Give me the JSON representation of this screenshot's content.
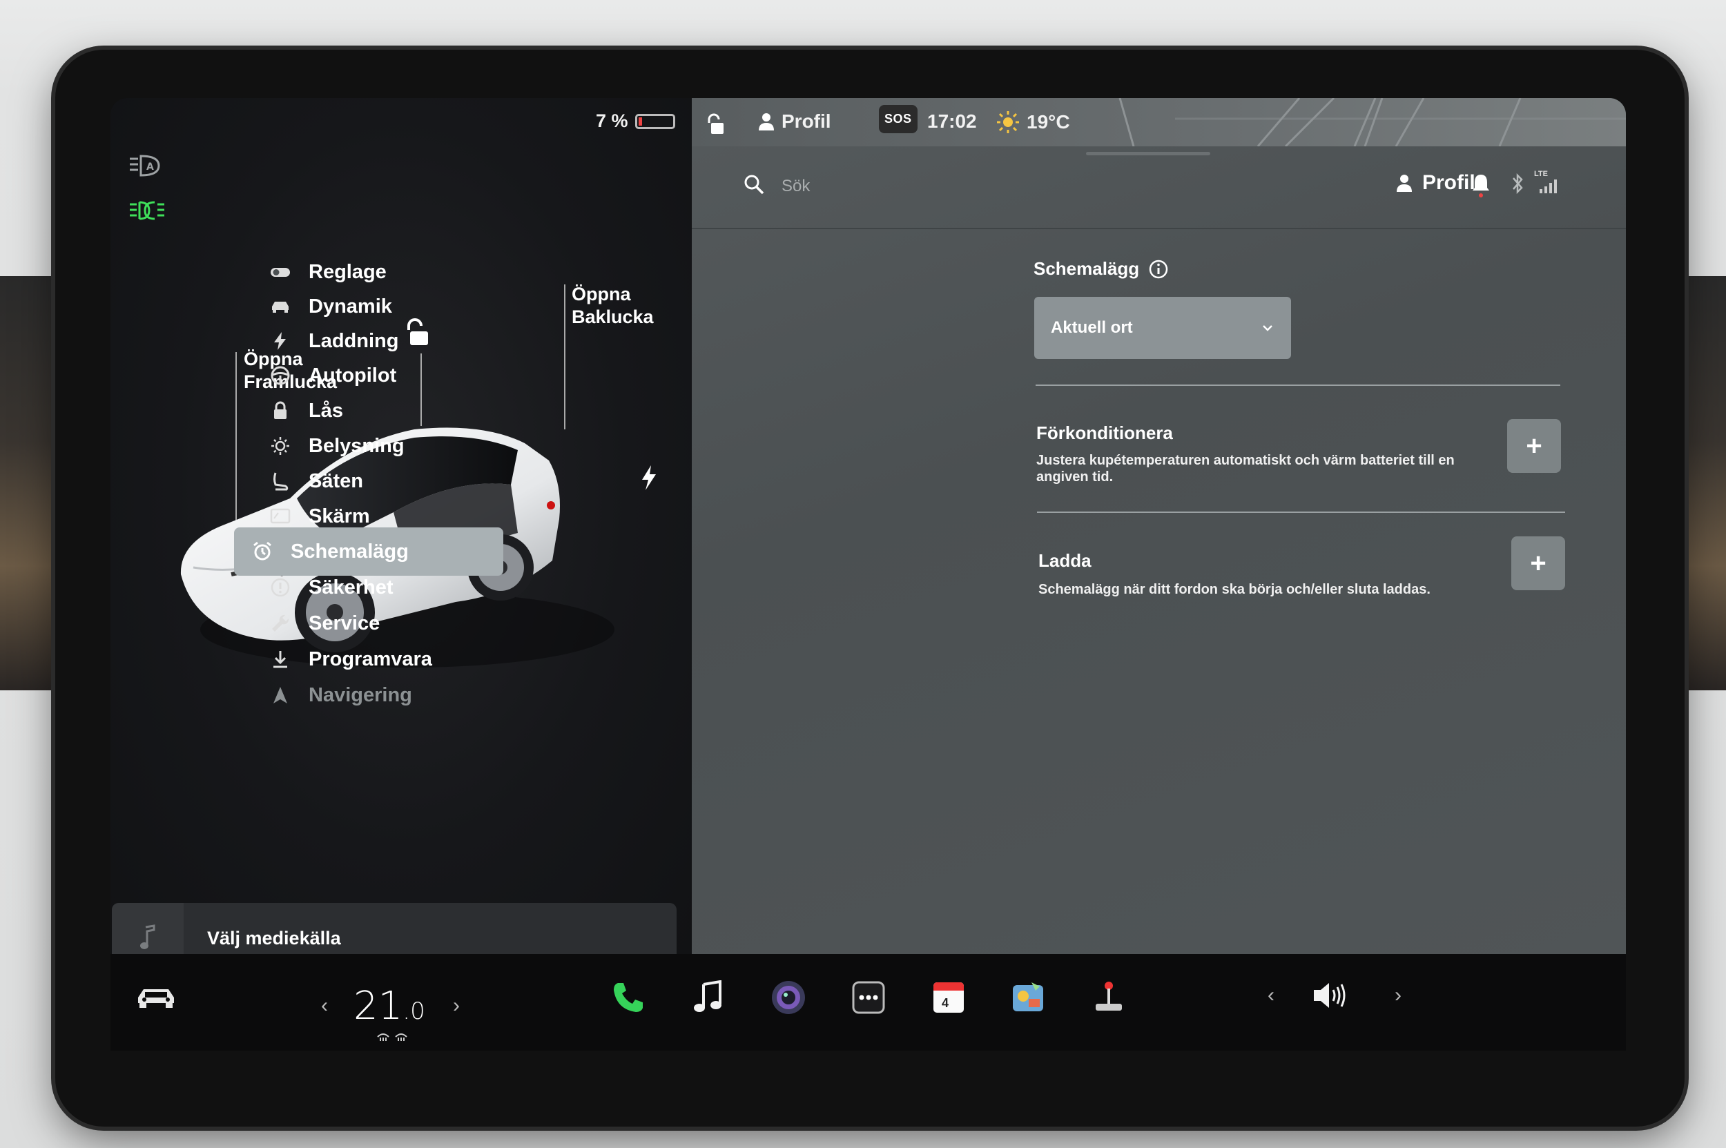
{
  "status_bar": {
    "battery_percent": "7 %",
    "profile": "Profil",
    "sos": "SOS",
    "time": "17:02",
    "temperature": "19°C"
  },
  "search": {
    "placeholder": "Sök",
    "profile_label": "Profil",
    "network": "LTE"
  },
  "car": {
    "frunk_label_1": "Öppna",
    "frunk_label_2": "Framlucka",
    "trunk_label_1": "Öppna",
    "trunk_label_2": "Baklucka"
  },
  "menu": [
    {
      "label": "Reglage",
      "icon": "toggle-icon"
    },
    {
      "label": "Dynamik",
      "icon": "car-icon"
    },
    {
      "label": "Laddning",
      "icon": "bolt-icon"
    },
    {
      "label": "Autopilot",
      "icon": "steering-wheel-icon"
    },
    {
      "label": "Lås",
      "icon": "lock-icon"
    },
    {
      "label": "Belysning",
      "icon": "sun-icon"
    },
    {
      "label": "Säten",
      "icon": "seat-icon"
    },
    {
      "label": "Skärm",
      "icon": "display-icon"
    },
    {
      "label": "Schemalägg",
      "icon": "alarm-clock-icon",
      "active": true
    },
    {
      "label": "Säkerhet",
      "icon": "alert-circle-icon"
    },
    {
      "label": "Service",
      "icon": "wrench-icon"
    },
    {
      "label": "Programvara",
      "icon": "download-icon"
    },
    {
      "label": "Navigering",
      "icon": "navigation-icon"
    }
  ],
  "schedule": {
    "title": "Schemalägg",
    "location_dropdown": "Aktuell ort",
    "precondition_title": "Förkonditionera",
    "precondition_desc": "Justera kupétemperaturen automatiskt och värm batteriet till en angiven tid.",
    "charge_title": "Ladda",
    "charge_desc": "Schemalägg när ditt fordon ska börja och/eller sluta laddas.",
    "add_label": "+"
  },
  "media": {
    "title": "Välj mediekälla"
  },
  "climate": {
    "temp_main": "21",
    "temp_decimal": ".0"
  },
  "dock": {
    "calendar_day": "4"
  },
  "colors": {
    "accent_green": "#36d35a",
    "headlight_green": "#3fe05a",
    "battery_red": "#e44444"
  }
}
